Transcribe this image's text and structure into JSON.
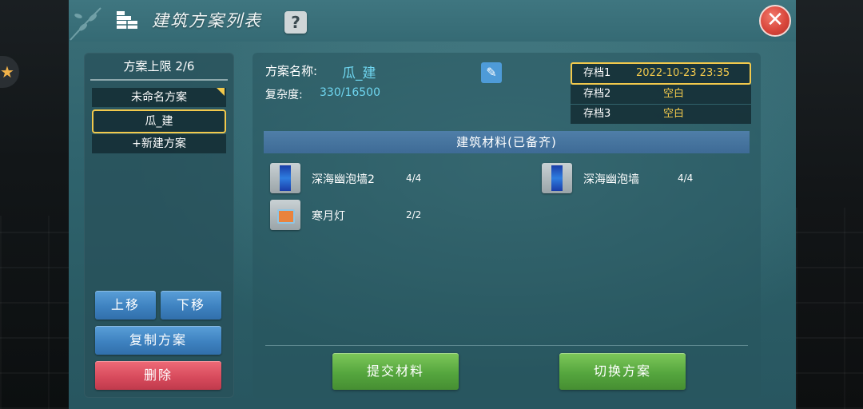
{
  "header": {
    "title": "建筑方案列表",
    "help_label": "?",
    "close_label": "✕"
  },
  "plan_list": {
    "cap_label": "方案上限",
    "cap_value": "2/6",
    "items": [
      "未命名方案",
      "瓜_建"
    ],
    "new_plan_label": "+新建方案",
    "selected_index": 1
  },
  "list_actions": {
    "move_up": "上移",
    "move_down": "下移",
    "copy": "复制方案",
    "delete": "删除"
  },
  "detail": {
    "name_label": "方案名称:",
    "name_value": "瓜_建",
    "complexity_label": "复杂度:",
    "complexity_value": "330/16500"
  },
  "save_slots": [
    {
      "label": "存档1",
      "value": "2022-10-23 23:35"
    },
    {
      "label": "存档2",
      "value": "空白"
    },
    {
      "label": "存档3",
      "value": "空白"
    }
  ],
  "materials": {
    "title": "建筑材料(已备齐)",
    "items": [
      {
        "name": "深海幽泡墙2",
        "count": "4/4",
        "icon": "wall-icon"
      },
      {
        "name": "深海幽泡墙",
        "count": "4/4",
        "icon": "wall-icon"
      },
      {
        "name": "寒月灯",
        "count": "2/2",
        "icon": "lamp-icon"
      }
    ]
  },
  "bottom_actions": {
    "submit": "提交材料",
    "switch": "切换方案"
  },
  "colors": {
    "accent_gold": "#f2c94c",
    "value_cyan": "#6fd6f0",
    "button_blue": "#3e82c0",
    "button_red": "#d6495b",
    "button_green": "#55a63e",
    "close_red": "#d9473c"
  }
}
